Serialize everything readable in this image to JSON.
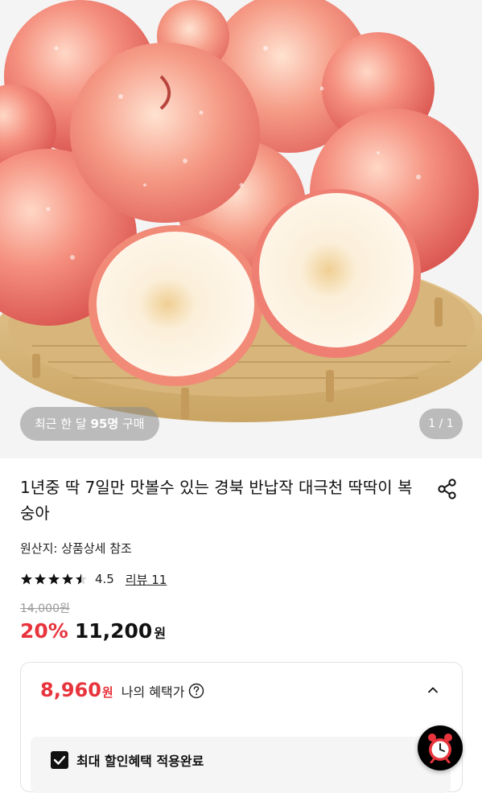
{
  "product_image": {
    "purchase_badge": {
      "prefix": "최근 한 달 ",
      "count": "95명",
      "suffix": " 구매"
    },
    "pager": "1 / 1"
  },
  "product": {
    "title": "1년중 딱 7일만 맛볼수 있는 경북 반납작 대극천 딱딱이 복숭아",
    "origin": "원산지: 상품상세 참조",
    "rating": 4.5,
    "rating_text": "4.5",
    "review_link": "리뷰 11",
    "original_price": "14,000원",
    "discount": "20%",
    "sale_price": "11,200",
    "currency": "원"
  },
  "benefit": {
    "price": "8,960",
    "currency": "원",
    "label": "나의 혜택가",
    "max_discount_label": "최대 할인혜택 적용완료"
  },
  "icons": {
    "share": "share-icon",
    "help": "question-circle-icon",
    "collapse": "chevron-up-icon",
    "alarm": "alarm-clock-icon",
    "star": "star-icon"
  },
  "colors": {
    "accent_red": "#e8343c",
    "text": "#111111",
    "muted": "#9a9a9a"
  }
}
